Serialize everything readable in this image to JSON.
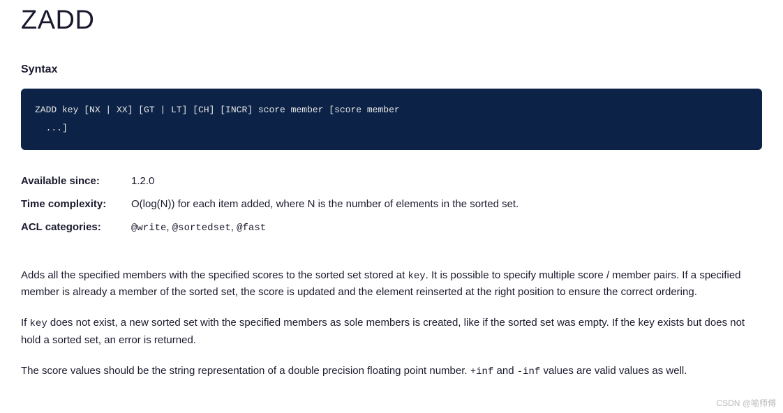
{
  "title": "ZADD",
  "syntax": {
    "heading": "Syntax",
    "code": "ZADD key [NX | XX] [GT | LT] [CH] [INCR] score member [score member\n  ...]"
  },
  "meta": {
    "available_since": {
      "label": "Available since:",
      "value": "1.2.0"
    },
    "time_complexity": {
      "label": "Time complexity:",
      "value": "O(log(N)) for each item added, where N is the number of elements in the sorted set."
    },
    "acl_categories": {
      "label": "ACL categories:",
      "items": [
        "@write",
        "@sortedset",
        "@fast"
      ]
    }
  },
  "description": {
    "p1_pre": "Adds all the specified members with the specified scores to the sorted set stored at ",
    "p1_code1": "key",
    "p1_post": ". It is possible to specify multiple score / member pairs. If a specified member is already a member of the sorted set, the score is updated and the element reinserted at the right position to ensure the correct ordering.",
    "p2_pre": "If ",
    "p2_code1": "key",
    "p2_post": " does not exist, a new sorted set with the specified members as sole members is created, like if the sorted set was empty. If the key exists but does not hold a sorted set, an error is returned.",
    "p3_pre": "The score values should be the string representation of a double precision floating point number. ",
    "p3_code1": "+inf",
    "p3_mid": " and ",
    "p3_code2": "-inf",
    "p3_post": " values are valid values as well."
  },
  "watermark": "CSDN @喻师傅"
}
